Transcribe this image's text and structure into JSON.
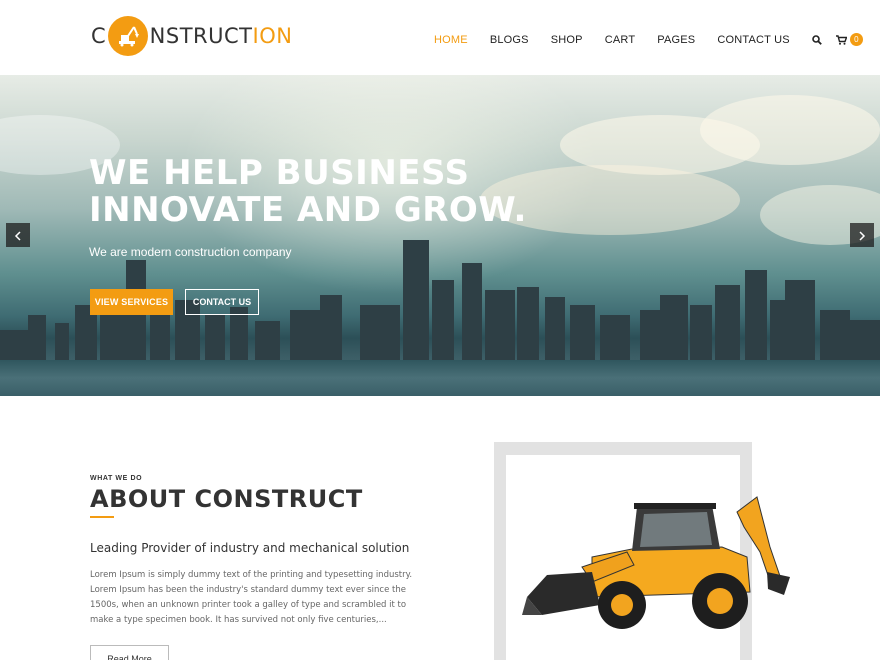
{
  "brand": {
    "logo_prefix": "C",
    "logo_main": "NSTRUCT",
    "logo_accent": "ION",
    "accent_color": "#f39c12"
  },
  "nav": {
    "items": [
      "HOME",
      "BLOGS",
      "SHOP",
      "CART",
      "PAGES",
      "CONTACT US"
    ],
    "active": "HOME",
    "search_icon": "search-icon",
    "cart_icon": "cart-icon",
    "cart_count": "0"
  },
  "hero": {
    "title_line1": "WE HELP BUSINESS",
    "title_line2": "INNOVATE AND GROW.",
    "subtitle": "We are modern construction company",
    "primary_button": "VIEW SERVICES",
    "secondary_button": "CONTACT US",
    "prev_icon": "chevron-left-icon",
    "next_icon": "chevron-right-icon"
  },
  "about": {
    "eyebrow": "WHAT WE DO",
    "title": "ABOUT CONSTRUCT",
    "lead": "Leading Provider of industry and mechanical solution",
    "body": "Lorem Ipsum is simply dummy text of the printing and typesetting industry. Lorem Ipsum has been the industry's standard dummy text ever since the 1500s, when an unknown printer took a galley of type and scrambled it to make a type specimen book. It has survived not only five centuries,...",
    "read_more": "Read More"
  }
}
